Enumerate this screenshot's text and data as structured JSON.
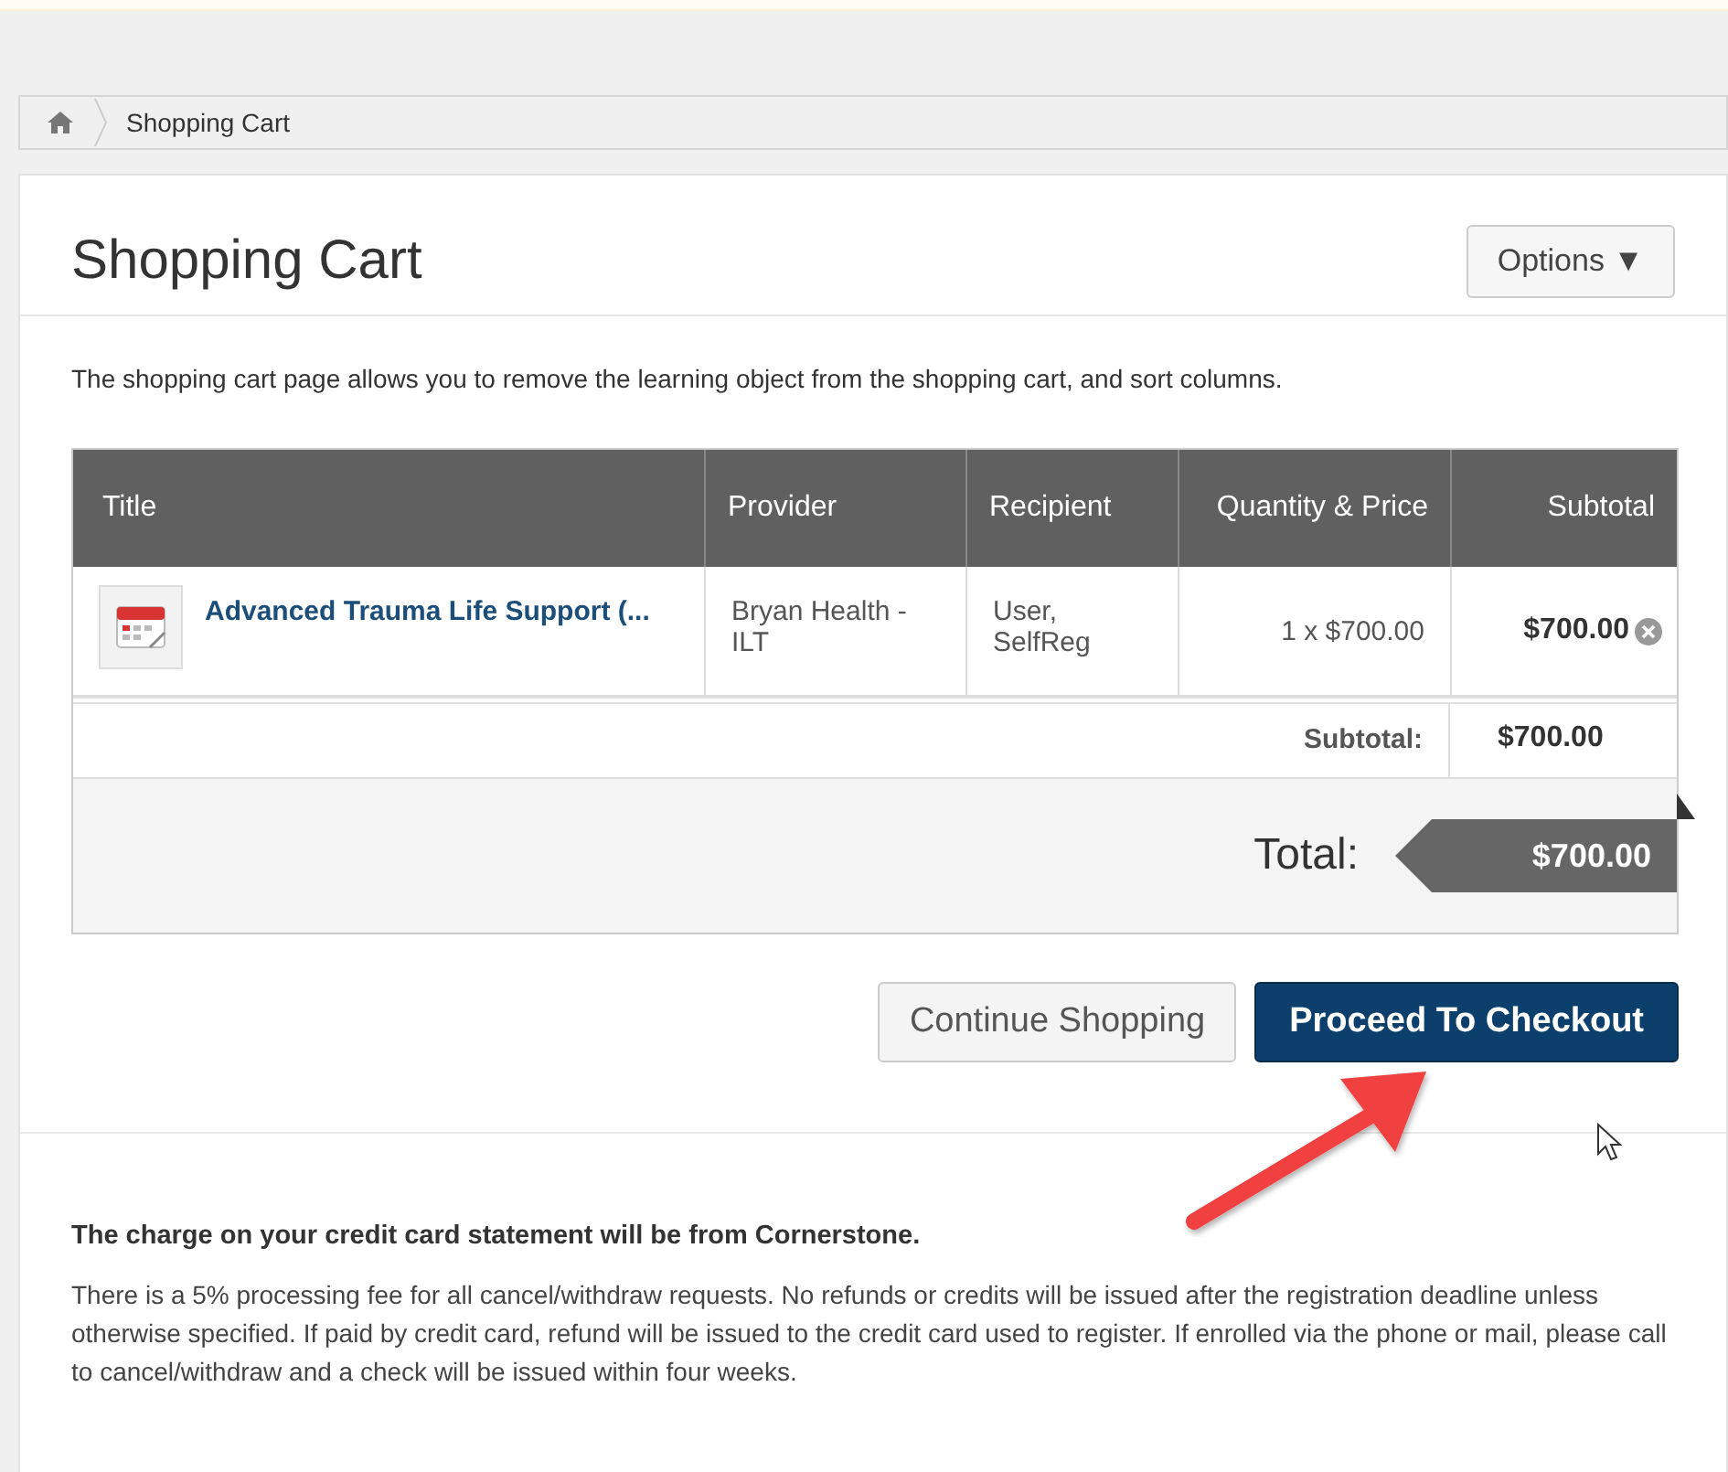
{
  "breadcrumb": {
    "items": [
      "Shopping Cart"
    ]
  },
  "page": {
    "title": "Shopping Cart",
    "options_button": "Options ▼",
    "description": "The shopping cart page allows you to remove the learning object from the shopping cart, and sort columns."
  },
  "table": {
    "columns": [
      "Title",
      "Provider",
      "Recipient",
      "Quantity & Price",
      "Subtotal"
    ],
    "rows": [
      {
        "title": "Advanced Trauma Life Support (...",
        "provider": "Bryan Health - ILT",
        "recipient": "User, SelfReg",
        "quantity_price": "1 x $700.00",
        "subtotal": "$700.00"
      }
    ],
    "subtotal_label": "Subtotal:",
    "subtotal_value": "$700.00",
    "total_label": "Total:",
    "total_value": "$700.00"
  },
  "buttons": [
    {
      "label": "Continue Shopping",
      "kind": "secondary"
    },
    {
      "label": "Proceed To Checkout",
      "kind": "primary"
    }
  ],
  "notice": {
    "heading": "The charge on your credit card statement will be from Cornerstone.",
    "text": "There is a 5% processing fee for all cancel/withdraw requests. No refunds or credits will be issued after the registration deadline unless otherwise specified. If paid by credit card, refund will be issued to the credit card used to register. If enrolled via the phone or mail, please call to cancel/withdraw and a check will be issued within four weeks."
  }
}
